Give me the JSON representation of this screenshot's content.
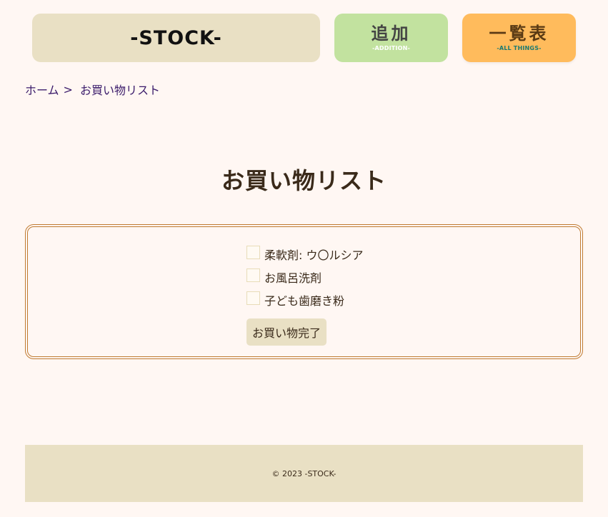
{
  "header": {
    "logo": "-STOCK-",
    "add": {
      "main": "追加",
      "sub": "-ADDITION-"
    },
    "list": {
      "main": "一覧表",
      "sub": "-ALL THINGS-"
    }
  },
  "breadcrumb": {
    "home": "ホーム",
    "separator": ">",
    "current": "お買い物リスト"
  },
  "page_title": "お買い物リスト",
  "shopping_list": {
    "items": [
      {
        "label": "柔軟剤: ウ〇ルシア",
        "checked": false
      },
      {
        "label": "お風呂洗剤",
        "checked": false
      },
      {
        "label": "子ども歯磨き粉",
        "checked": false
      }
    ],
    "done_button": "お買い物完了"
  },
  "footer": {
    "copyright": "© 2023 -STOCK-"
  },
  "colors": {
    "background": "#fff7f3",
    "logo_button": "#e9e0c4",
    "add_button": "#c2e29f",
    "list_button": "#ffbb5c",
    "list_border": "#c07a30",
    "link": "#3a1a6a"
  }
}
